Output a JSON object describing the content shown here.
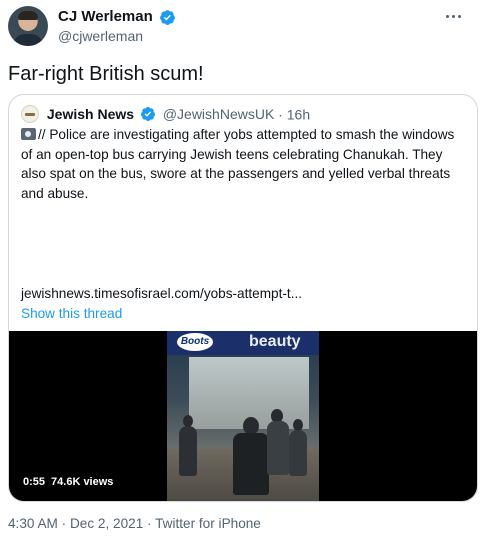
{
  "author": {
    "display_name": "CJ Werleman",
    "handle": "@cjwerleman",
    "verified": true,
    "avatar_icon": "profile-photo"
  },
  "tweet": {
    "text": "Far-right British scum!"
  },
  "quoted": {
    "name": "Jewish News",
    "handle": "@JewishNewsUK",
    "separator": " · ",
    "age": "16h",
    "verified": true,
    "body": "// Police are investigating after yobs attempted to smash the windows of an open-top bus carrying Jewish teens celebrating Chanukah. They also spat on the bus, swore at the passengers and yelled verbal threats and abuse.",
    "body_icon": "movie-camera-icon",
    "link": "jewishnews.timesofisrael.com/yobs-attempt-t...",
    "show_thread": "Show this thread",
    "video": {
      "store_logo_text": "Boots",
      "store_sign_text": "beauty",
      "duration": "0:55",
      "views": "74.6K views"
    }
  },
  "footer": {
    "meta": "4:30 AM · Dec 2, 2021 · Twitter for iPhone"
  },
  "colors": {
    "accent": "#1d9bf0",
    "secondary_text": "#536471",
    "border": "#cfd9de"
  }
}
